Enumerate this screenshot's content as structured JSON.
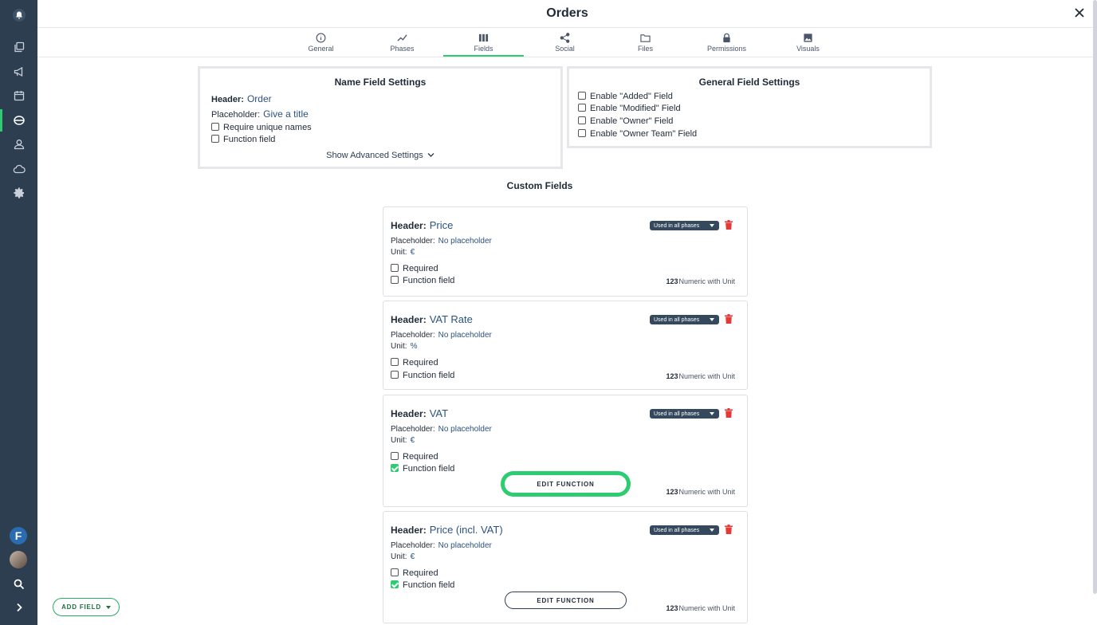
{
  "app": {
    "title": "Orders"
  },
  "tabs": [
    {
      "label": "General",
      "icon": "info-icon"
    },
    {
      "label": "Phases",
      "icon": "trend-icon"
    },
    {
      "label": "Fields",
      "icon": "columns-icon",
      "active": true
    },
    {
      "label": "Social",
      "icon": "share-icon"
    },
    {
      "label": "Files",
      "icon": "folder-icon"
    },
    {
      "label": "Permissions",
      "icon": "lock-icon"
    },
    {
      "label": "Visuals",
      "icon": "image-icon"
    }
  ],
  "sidebar": {
    "icons": [
      "bell-icon",
      "copy-icon",
      "megaphone-icon",
      "calendar-icon",
      "orders-icon",
      "users-icon",
      "cloud-icon",
      "gear-icon"
    ],
    "user_initial": "F",
    "accent_color": "#2ecc71",
    "bg_color": "#2c3e50"
  },
  "name_field_settings": {
    "title": "Name Field Settings",
    "header_label": "Header:",
    "header_value": "Order",
    "placeholder_label": "Placeholder:",
    "placeholder_value": "Give a title",
    "require_unique": "Require unique names",
    "function_field": "Function field",
    "advanced": "Show Advanced Settings"
  },
  "general_field_settings": {
    "title": "General Field Settings",
    "options": [
      "Enable \"Added\" Field",
      "Enable \"Modified\" Field",
      "Enable \"Owner\" Field",
      "Enable \"Owner Team\" Field"
    ]
  },
  "custom_fields": {
    "title": "Custom Fields",
    "header_label": "Header:",
    "placeholder_label": "Placeholder:",
    "unit_label": "Unit:",
    "required_label": "Required",
    "function_label": "Function field",
    "phase_pill": "Used in all phases",
    "type_num": "123",
    "type_label": "Numeric with Unit",
    "edit_function": "EDIT FUNCTION",
    "fields": [
      {
        "header": "Price",
        "placeholder": "No placeholder",
        "unit": "€",
        "required": false,
        "function": false
      },
      {
        "header": "VAT Rate",
        "placeholder": "No placeholder",
        "unit": "%",
        "required": false,
        "function": false
      },
      {
        "header": "VAT",
        "placeholder": "No placeholder",
        "unit": "€",
        "required": false,
        "function": true
      },
      {
        "header": "Price (incl. VAT)",
        "placeholder": "No placeholder",
        "unit": "€",
        "required": false,
        "function": true
      }
    ]
  },
  "add_field": "ADD FIELD"
}
